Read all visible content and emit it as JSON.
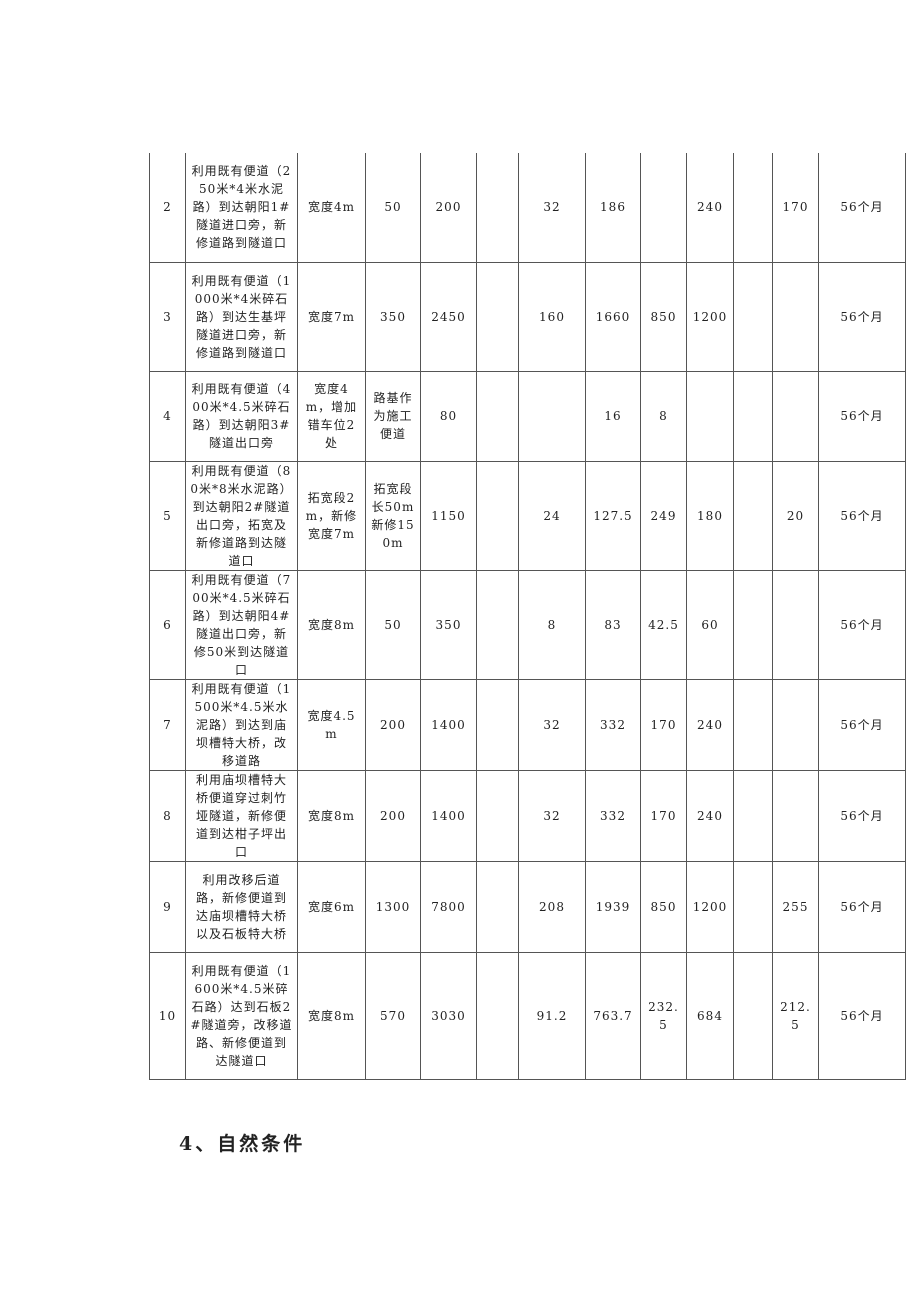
{
  "table": {
    "rows": [
      {
        "no": "2",
        "desc": "利用既有便道（250米*4米水泥路）到达朝阳1#隧道进口旁，新修道路到隧道口",
        "width": "宽度4m",
        "c3": "50",
        "c4": "200",
        "c5": "",
        "c6": "32",
        "c7": "186",
        "c8": "",
        "c9": "240",
        "c10": "",
        "c11": "170",
        "duration": "56个月"
      },
      {
        "no": "3",
        "desc": "利用既有便道（1000米*4米碎石路）到达生基坪隧道进口旁，新修道路到隧道口",
        "width": "宽度7m",
        "c3": "350",
        "c4": "2450",
        "c5": "",
        "c6": "160",
        "c7": "1660",
        "c8": "850",
        "c9": "1200",
        "c10": "",
        "c11": "",
        "duration": "56个月"
      },
      {
        "no": "4",
        "desc": "利用既有便道（400米*4.5米碎石路）到达朝阳3#隧道出口旁",
        "width": "宽度4m，增加错车位2处",
        "c3": "路基作为施工便道",
        "c4": "80",
        "c5": "",
        "c6": "",
        "c7": "16",
        "c8": "8",
        "c9": "",
        "c10": "",
        "c11": "",
        "duration": "56个月"
      },
      {
        "no": "5",
        "desc": "利用既有便道（80米*8米水泥路）到达朝阳2#隧道出口旁，拓宽及新修道路到达隧道口",
        "width": "拓宽段2m，新修宽度7m",
        "c3": "拓宽段长50m新修150m",
        "c4": "1150",
        "c5": "",
        "c6": "24",
        "c7": "127.5",
        "c8": "249",
        "c9": "180",
        "c10": "",
        "c11": "20",
        "duration": "56个月"
      },
      {
        "no": "6",
        "desc": "利用既有便道（700米*4.5米碎石路）到达朝阳4#隧道出口旁，新修50米到达隧道口",
        "width": "宽度8m",
        "c3": "50",
        "c4": "350",
        "c5": "",
        "c6": "8",
        "c7": "83",
        "c8": "42.5",
        "c9": "60",
        "c10": "",
        "c11": "",
        "duration": "56个月"
      },
      {
        "no": "7",
        "desc": "利用既有便道（1500米*4.5米水泥路）到达到庙坝槽特大桥，改移道路",
        "width": "宽度4.5m",
        "c3": "200",
        "c4": "1400",
        "c5": "",
        "c6": "32",
        "c7": "332",
        "c8": "170",
        "c9": "240",
        "c10": "",
        "c11": "",
        "duration": "56个月"
      },
      {
        "no": "8",
        "desc": "利用庙坝槽特大桥便道穿过刺竹垭隧道，新修便道到达柑子坪出口",
        "width": "宽度8m",
        "c3": "200",
        "c4": "1400",
        "c5": "",
        "c6": "32",
        "c7": "332",
        "c8": "170",
        "c9": "240",
        "c10": "",
        "c11": "",
        "duration": "56个月"
      },
      {
        "no": "9",
        "desc": "利用改移后道路，新修便道到达庙坝槽特大桥以及石板特大桥",
        "width": "宽度6m",
        "c3": "1300",
        "c4": "7800",
        "c5": "",
        "c6": "208",
        "c7": "1939",
        "c8": "850",
        "c9": "1200",
        "c10": "",
        "c11": "255",
        "duration": "56个月"
      },
      {
        "no": "10",
        "desc": "利用既有便道（1600米*4.5米碎石路）达到石板2#隧道旁，改移道路、新修便道到达隧道口",
        "width": "宽度8m",
        "c3": "570",
        "c4": "3030",
        "c5": "",
        "c6": "91.2",
        "c7": "763.7",
        "c8": "232.5",
        "c9": "684",
        "c10": "",
        "c11": "212.5",
        "duration": "56个月"
      }
    ]
  },
  "section_heading": "4、自然条件"
}
